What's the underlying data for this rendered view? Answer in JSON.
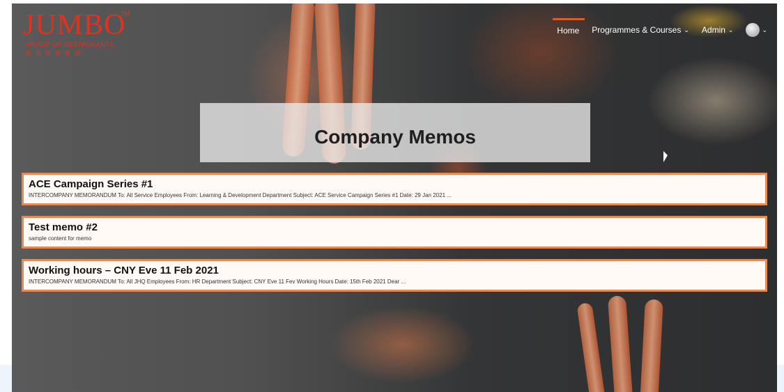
{
  "logo": {
    "word": "JUMBO",
    "trademark": "TM",
    "subtitle": "GROUP OF RESTAURANTS",
    "chinese": "珍宝饮食集团"
  },
  "nav": {
    "items": [
      {
        "label": "Home"
      },
      {
        "label": "Programmes & Courses"
      },
      {
        "label": "Admin"
      }
    ],
    "chevron": "⌄"
  },
  "page": {
    "title": "Company Memos"
  },
  "memos": [
    {
      "title": "ACE Campaign Series #1",
      "excerpt": "INTERCOMPANY MEMORANDUM To: All Service Employees From: Learning & Development Department Subject: ACE Service Campaign Series #1 Date: 29 Jan 2021 ..."
    },
    {
      "title": "Test memo #2",
      "excerpt": "sample content for memo"
    },
    {
      "title": "Working hours – CNY Eve 11 Feb 2021",
      "excerpt": "INTERCOMPANY MEMORANDUM To: All JHQ Employees From: HR Department Subject: CNY Eve 11 Fev Working Hours Date: 15th Feb 2021   Dear ..."
    }
  ],
  "colors": {
    "accent": "#e05a2a",
    "brand": "#e0321e",
    "memo_border": "#e58a55"
  }
}
